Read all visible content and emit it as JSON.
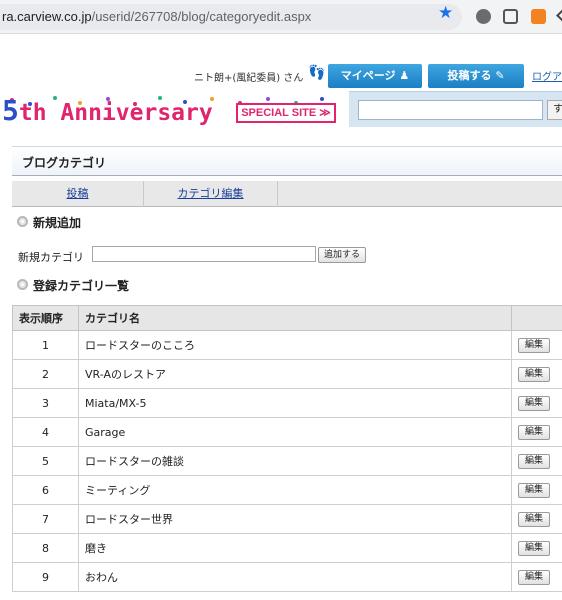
{
  "browser": {
    "url_host": "ra.carview.co.jp",
    "url_path": "/userid/267708/blog/categoryedit.aspx",
    "star_icon": "bookmark-star-icon",
    "extension_icons": [
      "extension-icon",
      "extension-icon",
      "rss-icon",
      "chevron-icon"
    ]
  },
  "header": {
    "user_greeting": "ニト朗+(風紀委員) さん",
    "mypage_label": "マイページ",
    "post_label": "投稿する",
    "logout_label": "ログア",
    "banner": {
      "digit": "5",
      "text": "th Anniversary",
      "special_label": "SPECIAL SITE ≫"
    },
    "search_button_label": "す"
  },
  "page": {
    "section_title": "ブログカテゴリ",
    "tabs": [
      {
        "label": "投稿"
      },
      {
        "label": "カテゴリ編集"
      }
    ],
    "new_heading": "新規追加",
    "new_category_label": "新規カテゴリ",
    "new_category_value": "",
    "add_button_label": "追加する",
    "list_heading": "登録カテゴリ一覧"
  },
  "table": {
    "headers": [
      "表示順序",
      "カテゴリ名",
      ""
    ],
    "edit_label": "編集",
    "rows": [
      {
        "order": "1",
        "name": "ロードスターのこころ"
      },
      {
        "order": "2",
        "name": "VR-Aのレストア"
      },
      {
        "order": "3",
        "name": "Miata/MX-5"
      },
      {
        "order": "4",
        "name": "Garage"
      },
      {
        "order": "5",
        "name": "ロードスターの雑談"
      },
      {
        "order": "6",
        "name": "ミーティング"
      },
      {
        "order": "7",
        "name": "ロードスター世界"
      },
      {
        "order": "8",
        "name": "磨き"
      },
      {
        "order": "9",
        "name": "おわん"
      }
    ]
  },
  "colors": {
    "accent_blue": "#1b7fc4",
    "anniversary_pink": "#e0246e",
    "link_blue": "#1a3f9a"
  }
}
